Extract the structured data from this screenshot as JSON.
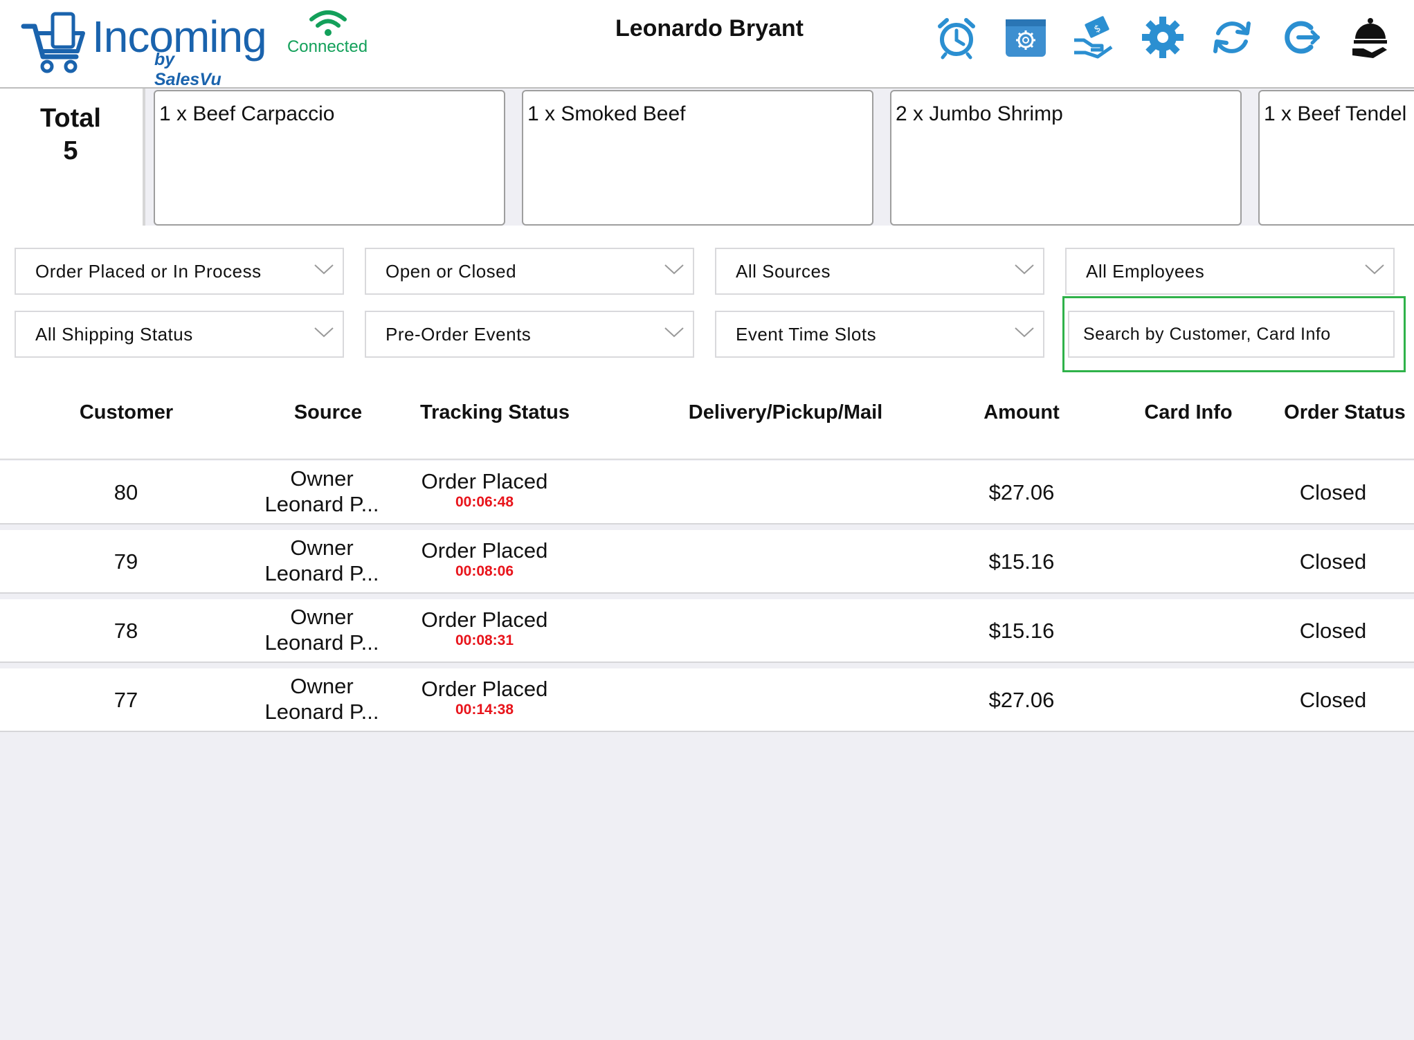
{
  "header": {
    "app_name": "Incoming",
    "app_sub": "by SalesVu",
    "connection_status": "Connected",
    "user_name": "Leonardo Bryant",
    "icons": [
      "alarm-clock-icon",
      "store-settings-icon",
      "cash-payment-icon",
      "gear-icon",
      "refresh-icon",
      "logout-icon",
      "service-bell-icon"
    ],
    "colors": {
      "brand": "#1a63ad",
      "connected": "#13a05a",
      "timer": "#e8141b",
      "highlight": "#2fb24a"
    }
  },
  "summary": {
    "total_label": "Total",
    "total_value": "5",
    "tickets": [
      "1 x Beef Carpaccio",
      "1 x Smoked Beef",
      "2 x Jumbo Shrimp",
      "1 x Beef Tendel"
    ]
  },
  "filters": {
    "status": "Order Placed or In Process",
    "open_closed": "Open or Closed",
    "sources": "All Sources",
    "employees": "All Employees",
    "shipping": "All Shipping Status",
    "pre_order": "Pre-Order Events",
    "time_slots": "Event Time Slots",
    "search_placeholder": "Search by Customer, Card Info"
  },
  "table": {
    "columns": [
      "Customer",
      "Source",
      "Tracking Status",
      "Delivery/Pickup/Mail",
      "Amount",
      "Card Info",
      "Order Status"
    ],
    "rows": [
      {
        "customer": "80",
        "source_line1": "Owner",
        "source_line2": "Leonard P...",
        "status": "Order Placed",
        "timer": "00:06:48",
        "delivery": "",
        "amount": "$27.06",
        "card": "",
        "order_status": "Closed"
      },
      {
        "customer": "79",
        "source_line1": "Owner",
        "source_line2": "Leonard P...",
        "status": "Order Placed",
        "timer": "00:08:06",
        "delivery": "",
        "amount": "$15.16",
        "card": "",
        "order_status": "Closed"
      },
      {
        "customer": "78",
        "source_line1": "Owner",
        "source_line2": "Leonard P...",
        "status": "Order Placed",
        "timer": "00:08:31",
        "delivery": "",
        "amount": "$15.16",
        "card": "",
        "order_status": "Closed"
      },
      {
        "customer": "77",
        "source_line1": "Owner",
        "source_line2": "Leonard P...",
        "status": "Order Placed",
        "timer": "00:14:38",
        "delivery": "",
        "amount": "$27.06",
        "card": "",
        "order_status": "Closed"
      }
    ]
  }
}
